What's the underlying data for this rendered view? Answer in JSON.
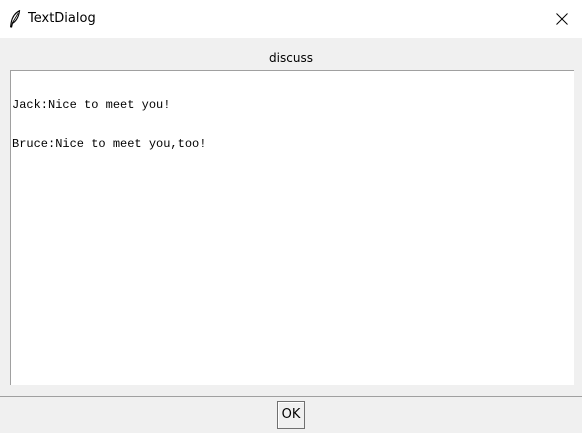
{
  "window": {
    "title": "TextDialog",
    "icon": "feather-icon",
    "close_icon": "close-icon"
  },
  "content": {
    "frame_label": "discuss",
    "text_lines": [
      "Jack:Nice to meet you!",
      "Bruce:Nice to meet you,too!"
    ]
  },
  "footer": {
    "ok_label": "OK"
  },
  "colors": {
    "window_bg": "#f0f0f0",
    "titlebar_bg": "#ffffff",
    "text_bg": "#ffffff",
    "border": "#a0a0a0"
  }
}
